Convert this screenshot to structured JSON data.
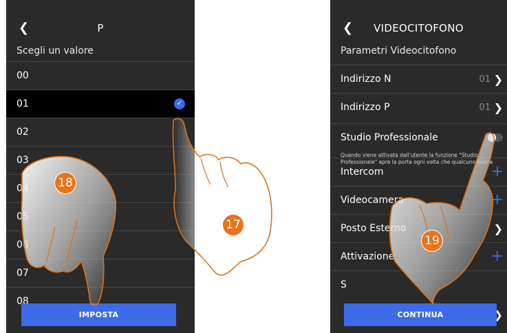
{
  "left_screen": {
    "back_icon": "chevron-left-icon",
    "title": "P",
    "subtitle": "Scegli un valore",
    "options": [
      "00",
      "01",
      "02",
      "03",
      "04",
      "05",
      "06",
      "07",
      "08"
    ],
    "selected": "01",
    "check_icon": "check-circle-icon",
    "button_label": "IMPOSTA"
  },
  "right_screen": {
    "back_icon": "chevron-left-icon",
    "title": "VIDEOCITOFONO",
    "subtitle": "Parametri Videocitofono",
    "rows": [
      {
        "label": "Indirizzo N",
        "value": "01",
        "action": "chevron"
      },
      {
        "label": "Indirizzo P",
        "value": "01",
        "action": "chevron"
      },
      {
        "label": "Studio Professionale",
        "action": "toggle"
      },
      {
        "label": "Intercom",
        "action": "plus"
      },
      {
        "label": "Videocamera",
        "action": "plus"
      },
      {
        "label": "Posto Esterno",
        "action": "chevron"
      },
      {
        "label": "Attivazione",
        "action": "plus"
      },
      {
        "label": "S",
        "action": "chevron"
      }
    ],
    "studio_note": "Quando viene attivata dall'utente la funzione \"Studio Professionale\" apre la porta ogni volta che qualcuno suona",
    "button_label": "CONTINUA"
  },
  "step_markers": [
    "18",
    "17",
    "19"
  ],
  "colors": {
    "screen_bg": "#2a2a2a",
    "selected_bg": "#000000",
    "accent_blue": "#3d6be8",
    "marker_orange": "#e8741c",
    "hand_outline": "#d9731c"
  }
}
